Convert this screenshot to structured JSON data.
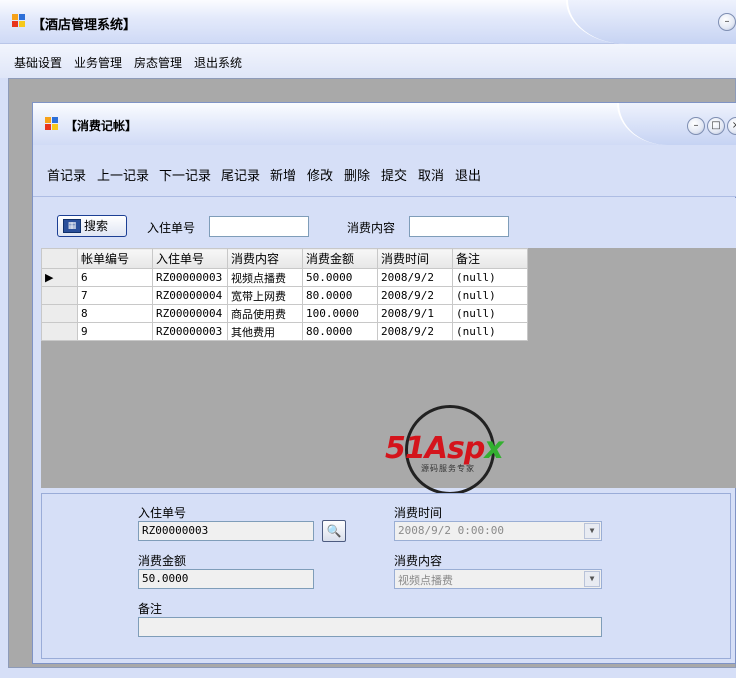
{
  "app": {
    "title": "【酒店管理系统】"
  },
  "menu": [
    "基础设置",
    "业务管理",
    "房态管理",
    "退出系统"
  ],
  "child": {
    "title": "【消费记帐】"
  },
  "toolbar": [
    "首记录",
    "上一记录",
    "下一记录",
    "尾记录",
    "新增",
    "修改",
    "删除",
    "提交",
    "取消",
    "退出"
  ],
  "search": {
    "button": "搜索",
    "checkin_label": "入住单号",
    "content_label": "消费内容",
    "checkin_value": "",
    "content_value": ""
  },
  "grid": {
    "headers": [
      "帐单编号",
      "入住单号",
      "消费内容",
      "消费金额",
      "消费时间",
      "备注"
    ],
    "rows": [
      [
        "6",
        "RZ00000003",
        "视频点播费",
        "50.0000",
        "2008/9/2",
        "(null)"
      ],
      [
        "7",
        "RZ00000004",
        "宽带上网费",
        "80.0000",
        "2008/9/2",
        "(null)"
      ],
      [
        "8",
        "RZ00000004",
        "商品使用费",
        "100.0000",
        "2008/9/1",
        "(null)"
      ],
      [
        "9",
        "RZ00000003",
        "其他费用",
        "80.0000",
        "2008/9/2",
        "(null)"
      ]
    ],
    "current_row_marker": "▶"
  },
  "watermark": {
    "brand": "51Aspx",
    "brand_num": "51",
    "brand_text": "Asp",
    "brand_x": "x",
    "tagline": "源码服务专家"
  },
  "detail": {
    "checkin_label": "入住单号",
    "checkin_value": "RZ00000003",
    "time_label": "消费时间",
    "time_value": "2008/9/2 0:00:00",
    "amount_label": "消费金额",
    "amount_value": "50.0000",
    "content_label": "消费内容",
    "content_value": "视频点播费",
    "note_label": "备注",
    "note_value": ""
  },
  "colors": {
    "accent": "#d6dff7",
    "brand_red": "#d4141c",
    "brand_green": "#33b030"
  }
}
